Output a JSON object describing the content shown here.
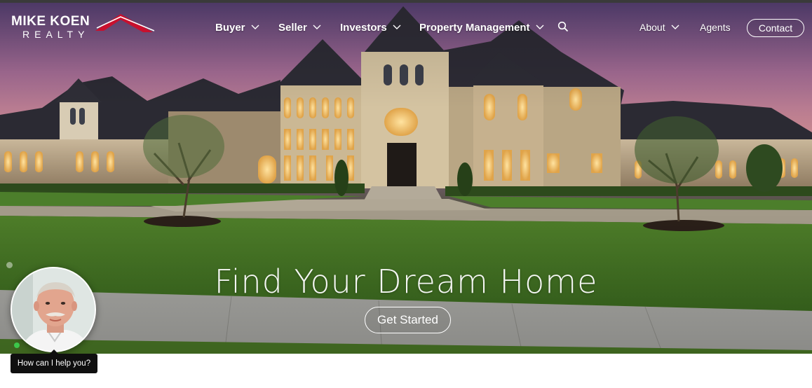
{
  "brand": {
    "name": "MIKE KOEN",
    "sub": "REALTY",
    "roof_color": "#c8102e"
  },
  "nav": {
    "items": [
      {
        "label": "Buyer",
        "has_dropdown": true
      },
      {
        "label": "Seller",
        "has_dropdown": true
      },
      {
        "label": "Investors",
        "has_dropdown": true
      },
      {
        "label": "Property Management",
        "has_dropdown": true
      }
    ],
    "search_icon": "search-icon",
    "right_items": [
      {
        "label": "About",
        "has_dropdown": true
      },
      {
        "label": "Agents",
        "has_dropdown": false
      }
    ],
    "contact_label": "Contact"
  },
  "hero": {
    "title": "Find Your Dream Home",
    "cta_label": "Get Started"
  },
  "chat": {
    "prompt": "How can I help you?",
    "status_color": "#3cc74a"
  }
}
